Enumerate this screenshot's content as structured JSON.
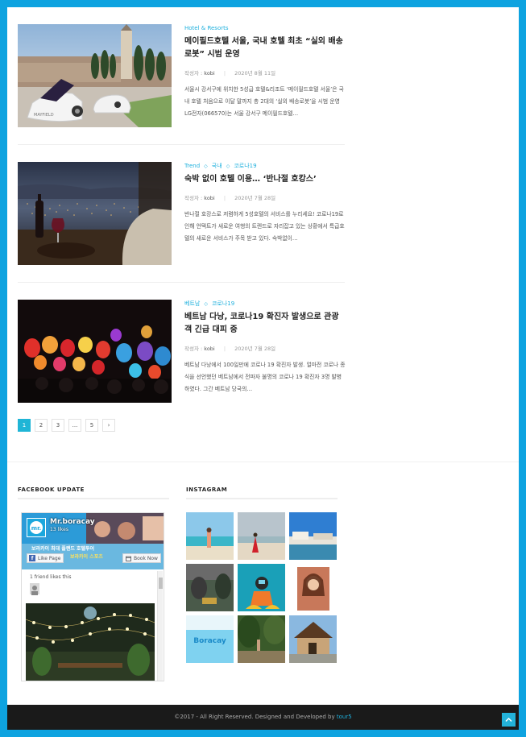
{
  "posts": [
    {
      "categories": [
        "Hotel & Resorts"
      ],
      "title": "메이필드호텔 서울, 국내 호텔 최초 “실외 배송로봇” 시범 운영",
      "author_label": "작성자 :",
      "author": "kobi",
      "date": "2020년 8월 11일",
      "excerpt": "서울시 강서구에 위치한 5성급 호텔&리조트 ‘메이필드호텔 서울’은 국내 호텔 처음으로 이달 말까지 총 2대의 ‘실외 배송로봇’을 시범 운영 LG전자(066570)는 서울 강서구 메이필드호텔…",
      "image_caption": "MAYFIELD"
    },
    {
      "categories": [
        "Trend",
        "국내",
        "코로나19"
      ],
      "title": "숙박 없이 호텔 이용… ‘반나절 호캉스’",
      "author_label": "작성자 :",
      "author": "kobi",
      "date": "2020년 7월 28일",
      "excerpt": "반나절 호캉스로 저렴하게 5성호텔의 서비스를 누리세요! 코로나19로 인해 언택트가 새로운 여행의 트렌드로 자리잡고 있는 상황에서 특급호텔의 새로운 서비스가 주목 받고 있다. 숙박없이…"
    },
    {
      "categories": [
        "베트남",
        "코로나19"
      ],
      "title": "베트남 다낭, 코로나19 확진자 발생으로 관광객 긴급 대피 중",
      "author_label": "작성자 :",
      "author": "kobi",
      "date": "2020년 7월 28일",
      "excerpt": "베트남 다낭에서 100일만에 코로나 19 확진자 발생. 얼마전 코로나 종식을 선언했던 베트남에서 전파자 불명의 코로나 19 확진자 3명 발병하였다. 그간 베트남 당국의…"
    }
  ],
  "category_separator": "◇",
  "pagination": [
    "1",
    "2",
    "3",
    "...",
    "5",
    "›"
  ],
  "pagination_active": 0,
  "widgets": {
    "facebook_title": "FACEBOOK UPDATE",
    "instagram_title": "INSTAGRAM"
  },
  "facebook": {
    "page_name": "Mr.boracay",
    "likes": "13 likes",
    "like_button": "Like Page",
    "book_button": "Book Now",
    "friends": "1 friend likes this",
    "cover_text_1": "보라카이 최대 플랜드 호텔투어",
    "cover_text_2": "보라카이 스포츠"
  },
  "instagram": {
    "photos": [
      "beach-girl",
      "beach-red-dress",
      "coast-hotel",
      "rocks-jeep",
      "snorkel",
      "selfie",
      "boracay-logo",
      "forest-path",
      "villa"
    ],
    "logo_text": "Boracay"
  },
  "footer": {
    "copyright": "©2017 - All Right Reserved. Designed and Developed by ",
    "brand": "tour5"
  },
  "colors": {
    "accent": "#1fb0dd",
    "border": "#0ea3e0",
    "footer_bg": "#1a1a1a"
  }
}
